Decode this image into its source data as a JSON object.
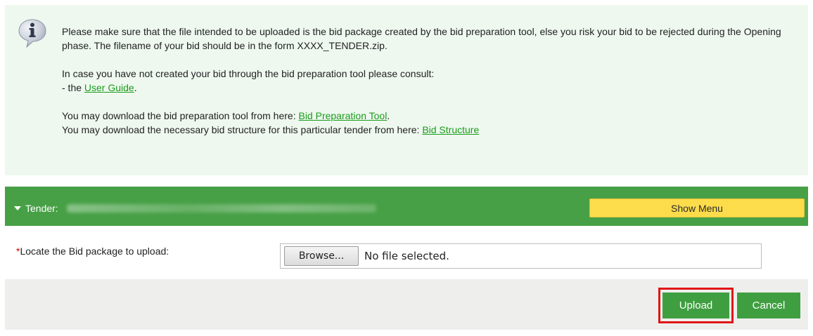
{
  "info": {
    "icon": "info-speech-bubble-icon",
    "paragraph1": "Please make sure that the file intended to be uploaded is the bid package created by the bid preparation tool, else you risk your bid to be rejected during the Opening phase. The filename of your bid should be in the form XXXX_TENDER.zip.",
    "paragraph2_intro": "In case you have not created your bid through the bid preparation tool please consult:",
    "paragraph2_prefix": "- the ",
    "user_guide_link": "User Guide",
    "paragraph2_suffix": ".",
    "tool_prefix": "You may download the bid preparation tool from here: ",
    "tool_link": "Bid Preparation Tool",
    "tool_suffix": ".",
    "structure_prefix": "You may download the necessary bid structure for this particular tender from here: ",
    "structure_link": "Bid Structure"
  },
  "tender_bar": {
    "label": "Tender:",
    "show_menu_label": "Show Menu"
  },
  "upload_form": {
    "required_marker": "*",
    "field_label": "Locate the Bid package to upload:",
    "browse_label": "Browse...",
    "file_status": "No file selected."
  },
  "actions": {
    "upload_label": "Upload",
    "cancel_label": "Cancel"
  },
  "colors": {
    "info_background": "#eef8ef",
    "header_green": "#47a046",
    "button_green": "#3f9f40",
    "show_menu_yellow": "#fddc4b",
    "highlight_red": "#e01616",
    "link_green": "#1a9c1a"
  }
}
